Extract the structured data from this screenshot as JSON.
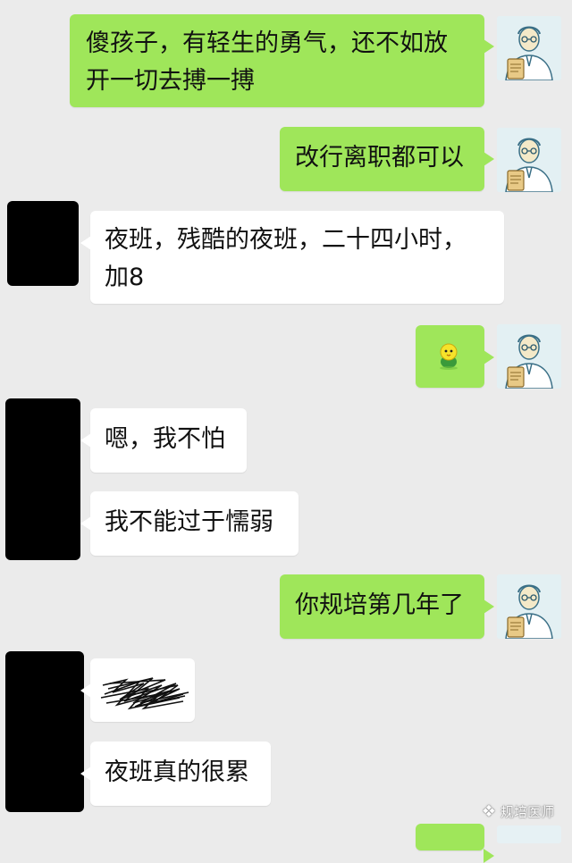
{
  "messages": [
    {
      "text": "傻孩子，有轻生的勇气，还不如放开一切去搏一搏"
    },
    {
      "text": "改行离职都可以"
    },
    {
      "text": "夜班，残酷的夜班，二十四小时，加8"
    },
    {
      "text": "嗯，我不怕"
    },
    {
      "text": "我不能过于懦弱"
    },
    {
      "text": "你规培第几年了"
    },
    {
      "text": "夜班真的很累"
    }
  ],
  "watermark": {
    "text": "规培医师",
    "icon": "wechat-icon"
  },
  "colors": {
    "background": "#ebebeb",
    "sent_bubble": "#9fe65a",
    "received_bubble": "#ffffff"
  }
}
